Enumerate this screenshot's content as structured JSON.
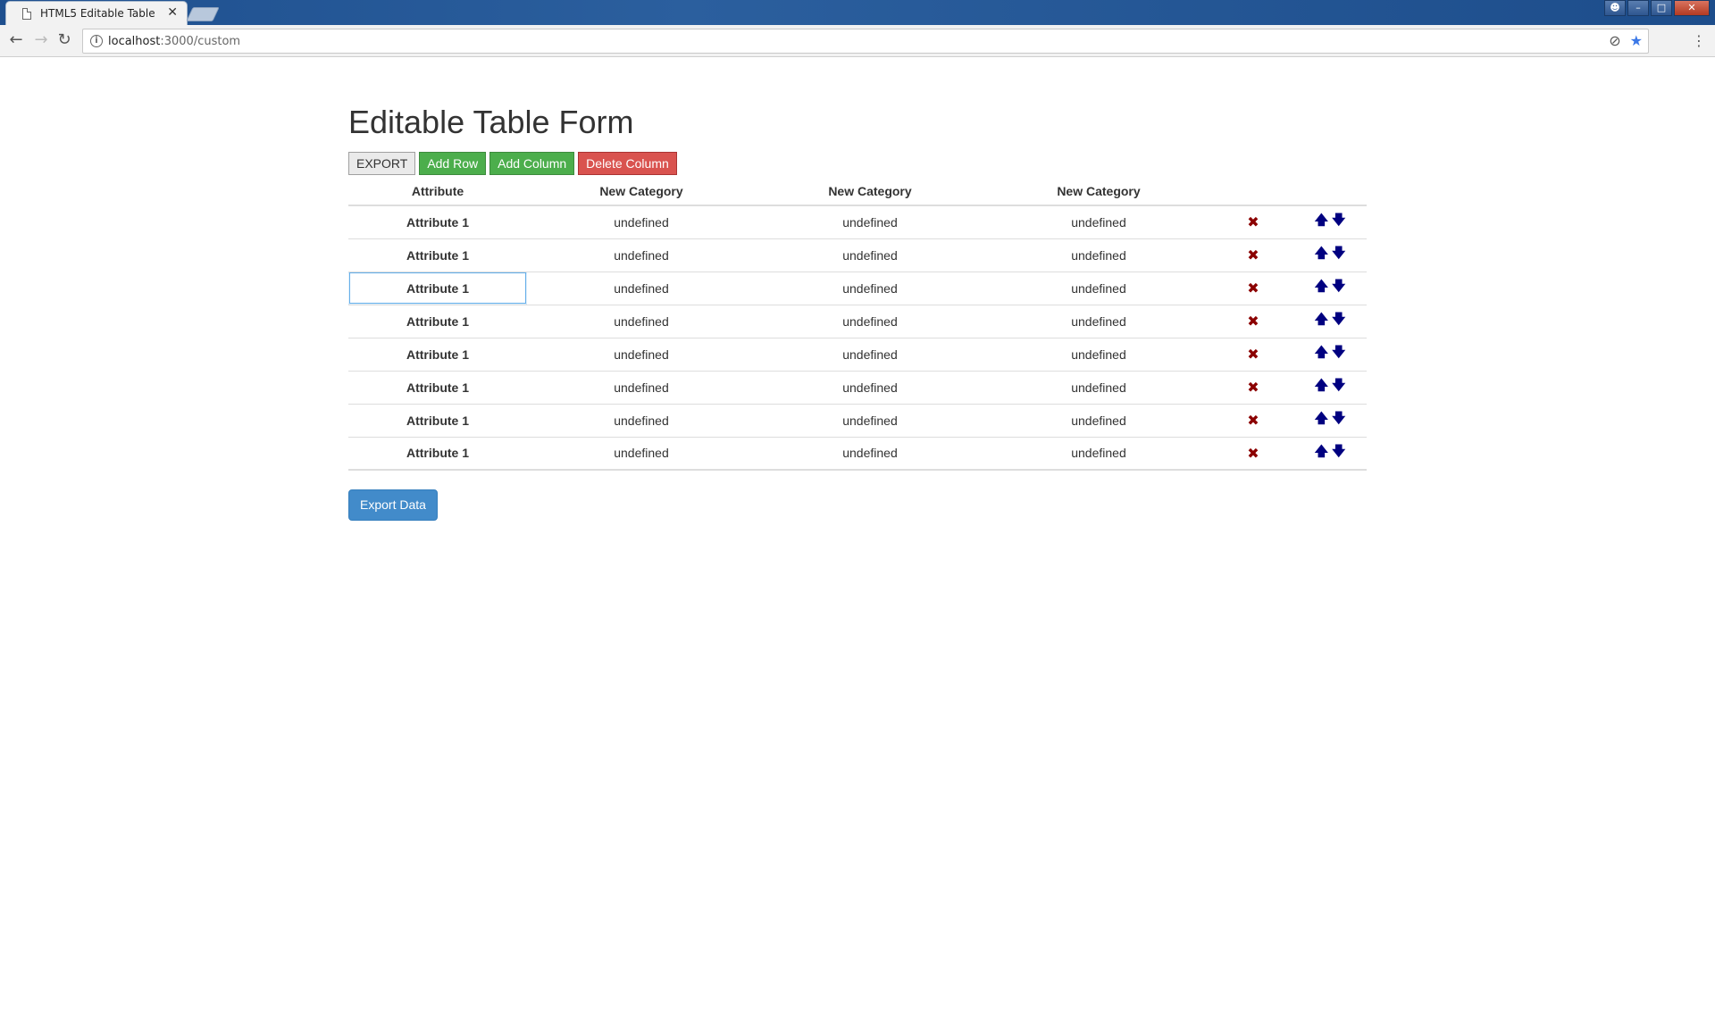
{
  "browser": {
    "tab_title": "HTML5 Editable Table",
    "tab_close": "✕",
    "url_host": "localhost",
    "url_path": ":3000/custom"
  },
  "page": {
    "title": "Editable Table Form",
    "buttons": {
      "export": "EXPORT",
      "add_row": "Add Row",
      "add_column": "Add Column",
      "delete_column": "Delete Column",
      "export_data": "Export Data"
    }
  },
  "table": {
    "headers": [
      "Attribute",
      "New Category",
      "New Category",
      "New Category"
    ],
    "rows": [
      {
        "attribute": "Attribute 1",
        "cells": [
          "undefined",
          "undefined",
          "undefined"
        ]
      },
      {
        "attribute": "Attribute 1",
        "cells": [
          "undefined",
          "undefined",
          "undefined"
        ]
      },
      {
        "attribute": "Attribute 1",
        "cells": [
          "undefined",
          "undefined",
          "undefined"
        ]
      },
      {
        "attribute": "Attribute 1",
        "cells": [
          "undefined",
          "undefined",
          "undefined"
        ]
      },
      {
        "attribute": "Attribute 1",
        "cells": [
          "undefined",
          "undefined",
          "undefined"
        ]
      },
      {
        "attribute": "Attribute 1",
        "cells": [
          "undefined",
          "undefined",
          "undefined"
        ]
      },
      {
        "attribute": "Attribute 1",
        "cells": [
          "undefined",
          "undefined",
          "undefined"
        ]
      },
      {
        "attribute": "Attribute 1",
        "cells": [
          "undefined",
          "undefined",
          "undefined"
        ]
      }
    ],
    "editing_row": 2,
    "icons": {
      "remove": "✖",
      "up": "🡅",
      "down": "🡇"
    }
  },
  "colors": {
    "success": "#4cae4c",
    "danger": "#d9534f",
    "primary": "#428bca",
    "remove_icon": "#8b0000",
    "arrow_icon": "#000080"
  }
}
